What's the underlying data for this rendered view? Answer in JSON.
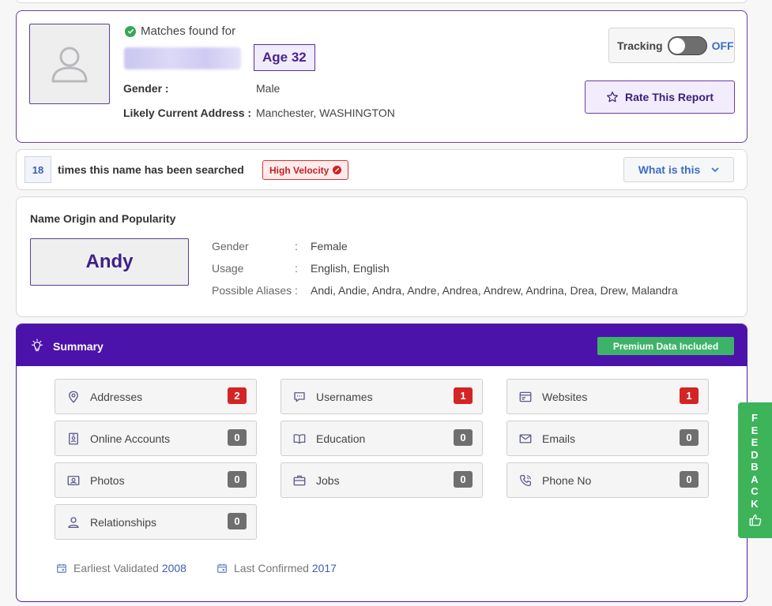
{
  "profile": {
    "matches_label": "Matches found for",
    "age": "Age 32",
    "gender_label": "Gender :",
    "gender_value": "Male",
    "address_label": "Likely Current Address :",
    "address_value": "Manchester, WASHINGTON",
    "tracking_label": "Tracking",
    "tracking_state": "OFF",
    "rate_label": "Rate This Report"
  },
  "searched": {
    "count": "18",
    "text": "times this name has been searched",
    "velocity": "High Velocity",
    "what_label": "What is this"
  },
  "origin": {
    "title": "Name Origin and Popularity",
    "name": "Andy",
    "rows": [
      {
        "label": "Gender",
        "colon": ":",
        "value": "Female"
      },
      {
        "label": "Usage",
        "colon": ":",
        "value": "English, English"
      },
      {
        "label": "Possible Aliases",
        "colon": ":",
        "value": "Andi, Andie, Andra, Andre, Andrea, Andrew, Andrina, Drea, Drew, Malandra"
      }
    ]
  },
  "summary": {
    "title": "Summary",
    "premium": "Premium Data Included",
    "tiles": [
      {
        "label": "Addresses",
        "count": "2",
        "icon": "location-pin-icon",
        "status": "red"
      },
      {
        "label": "Usernames",
        "count": "1",
        "icon": "chat-bubble-icon",
        "status": "red"
      },
      {
        "label": "Websites",
        "count": "1",
        "icon": "browser-window-icon",
        "status": "red"
      },
      {
        "label": "Online Accounts",
        "count": "0",
        "icon": "id-badge-icon",
        "status": "gray"
      },
      {
        "label": "Education",
        "count": "0",
        "icon": "open-book-icon",
        "status": "gray"
      },
      {
        "label": "Emails",
        "count": "0",
        "icon": "envelope-icon",
        "status": "gray"
      },
      {
        "label": "Photos",
        "count": "0",
        "icon": "photo-icon",
        "status": "gray"
      },
      {
        "label": "Jobs",
        "count": "0",
        "icon": "briefcase-icon",
        "status": "gray"
      },
      {
        "label": "Phone No",
        "count": "0",
        "icon": "phone-icon",
        "status": "gray"
      },
      {
        "label": "Relationships",
        "count": "0",
        "icon": "person-icon",
        "status": "gray"
      }
    ],
    "earliest_label": "Earliest Validated",
    "earliest_year": "2008",
    "last_label": "Last Confirmed",
    "last_year": "2017"
  },
  "feedback": {
    "letters": [
      "F",
      "E",
      "E",
      "D",
      "B",
      "A",
      "C",
      "K"
    ]
  },
  "colors": {
    "brand_purple": "#4b13a9",
    "count_red": "#d42424",
    "count_gray": "#6f6f6f",
    "premium_green": "#3db36a",
    "link_blue": "#3a6fc4"
  }
}
